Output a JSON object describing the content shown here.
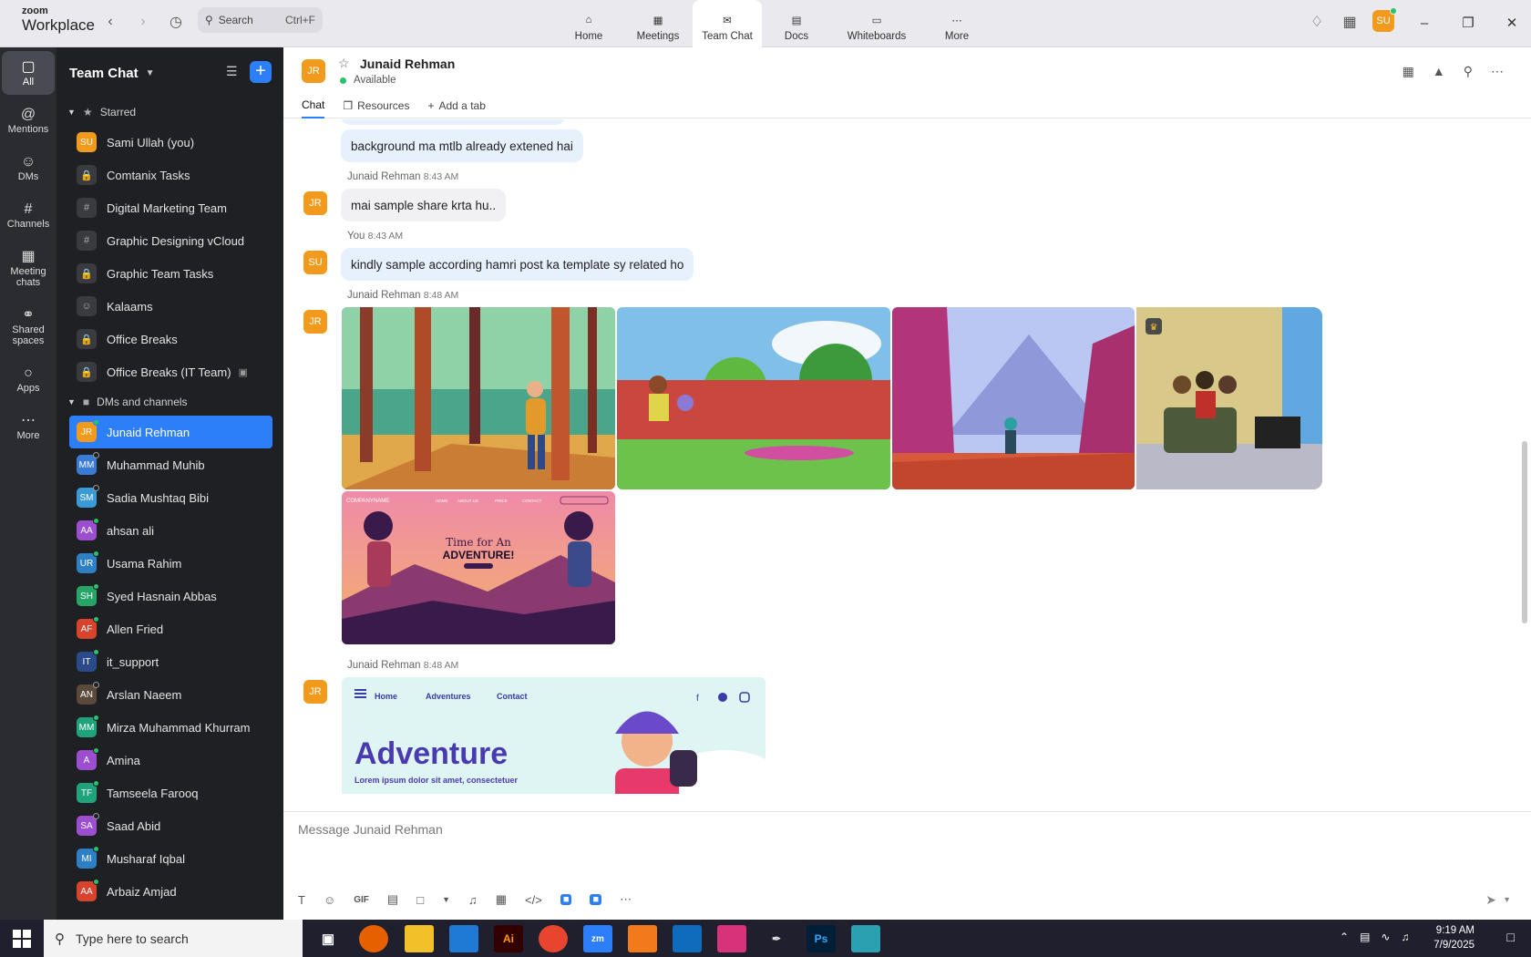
{
  "app": {
    "logo_top": "zoom",
    "logo_bottom": "Workplace"
  },
  "titlebar": {
    "search_label": "Search",
    "search_shortcut": "Ctrl+F",
    "nav": [
      {
        "label": "Home",
        "icon": "home-icon"
      },
      {
        "label": "Meetings",
        "icon": "video-icon"
      },
      {
        "label": "Team Chat",
        "icon": "chat-icon"
      },
      {
        "label": "Docs",
        "icon": "doc-icon"
      },
      {
        "label": "Whiteboards",
        "icon": "whiteboard-icon"
      },
      {
        "label": "More",
        "icon": "more-icon"
      }
    ],
    "user_initials": "SU"
  },
  "rail": [
    {
      "label": "All",
      "icon": "chat-bubble-icon"
    },
    {
      "label": "Mentions",
      "icon": "at-icon"
    },
    {
      "label": "DMs",
      "icon": "people-icon"
    },
    {
      "label": "Channels",
      "icon": "hash-icon"
    },
    {
      "label": "Meeting chats",
      "icon": "calendar-icon"
    },
    {
      "label": "Shared spaces",
      "icon": "share-icon"
    },
    {
      "label": "Apps",
      "icon": "apps-icon"
    },
    {
      "label": "More",
      "icon": "more-icon"
    }
  ],
  "sidebar": {
    "title": "Team Chat",
    "starred_label": "Starred",
    "starred": [
      {
        "name": "Sami Ullah (you)",
        "initials": "SU",
        "color": "#f29a1b",
        "type": "avatar"
      },
      {
        "name": "Comtanix Tasks",
        "type": "lock"
      },
      {
        "name": "Digital Marketing Team",
        "type": "hash"
      },
      {
        "name": "Graphic Designing vCloud",
        "type": "hash"
      },
      {
        "name": "Graphic Team Tasks",
        "type": "lock"
      },
      {
        "name": "Kalaams",
        "type": "group"
      },
      {
        "name": "Office Breaks",
        "type": "lock"
      },
      {
        "name": "Office Breaks (IT Team)",
        "type": "lock"
      }
    ],
    "dms_label": "DMs and channels",
    "dms": [
      {
        "name": "Junaid Rehman",
        "initials": "JR",
        "color": "#f29a1b",
        "status": "on",
        "active": true
      },
      {
        "name": "Muhammad Muhib",
        "initials": "MM",
        "color": "#3a7bd5",
        "status": "off"
      },
      {
        "name": "Sadia Mushtaq Bibi",
        "initials": "SM",
        "color": "#3a9ad5",
        "status": "off"
      },
      {
        "name": "ahsan ali",
        "initials": "AA",
        "color": "#9b4fd0",
        "status": "on"
      },
      {
        "name": "Usama Rahim",
        "initials": "UR",
        "color": "#2f7fc4",
        "status": "on"
      },
      {
        "name": "Syed Hasnain Abbas",
        "initials": "SH",
        "color": "#27a566",
        "status": "on"
      },
      {
        "name": "Allen Fried",
        "initials": "AF",
        "color": "#d8432e",
        "status": "on"
      },
      {
        "name": "it_support",
        "initials": "IT",
        "color": "#2a4a8a",
        "status": "on"
      },
      {
        "name": "Arslan Naeem",
        "initials": "AN",
        "color": "#5a4a3a",
        "status": "off"
      },
      {
        "name": "Mirza Muhammad Khurram",
        "initials": "MM",
        "color": "#1fa37a",
        "status": "on"
      },
      {
        "name": "Amina",
        "initials": "A",
        "color": "#9b4fd0",
        "status": "on"
      },
      {
        "name": "Tamseela Farooq",
        "initials": "TF",
        "color": "#1fa37a",
        "status": "on"
      },
      {
        "name": "Saad Abid",
        "initials": "SA",
        "color": "#9b4fd0",
        "status": "off"
      },
      {
        "name": "Musharaf Iqbal",
        "initials": "MI",
        "color": "#2f7fc4",
        "status": "on"
      },
      {
        "name": "Arbaiz Amjad",
        "initials": "AA",
        "color": "#d8432e",
        "status": "on"
      }
    ]
  },
  "chat": {
    "name": "Junaid Rehman",
    "initials": "JR",
    "status": "Available",
    "tabs": [
      "Chat",
      "Resources",
      "Add a tab"
    ],
    "messages": {
      "m1": "background ma mtlb already extened hai",
      "s2": "Junaid Rehman",
      "t2": "8:43 AM",
      "m2": "mai sample share krta hu..",
      "s3": "You",
      "t3": "8:43 AM",
      "you_initials": "SU",
      "m3": "kindly sample according hamri post ka template sy related ho",
      "s4": "Junaid Rehman",
      "t4": "8:48 AM",
      "s5": "Junaid Rehman",
      "t5": "8:48 AM"
    },
    "images_text": {
      "company": "COMPANYNAME",
      "nav": [
        "HOME",
        "ABOUT US",
        "PRICE",
        "CONTACT"
      ],
      "tagline1": "Time for An",
      "tagline2": "ADVENTURE!",
      "web_nav": [
        "Home",
        "Adventures",
        "Contact"
      ],
      "web_title": "Adventure",
      "web_sub": "Lorem ipsum dolor sit amet, consectetuer"
    },
    "composer_placeholder": "Message Junaid Rehman",
    "composer_gif": "GIF"
  },
  "taskbar": {
    "search_placeholder": "Type here to search",
    "time": "9:19 AM",
    "date": "7/9/2025"
  }
}
